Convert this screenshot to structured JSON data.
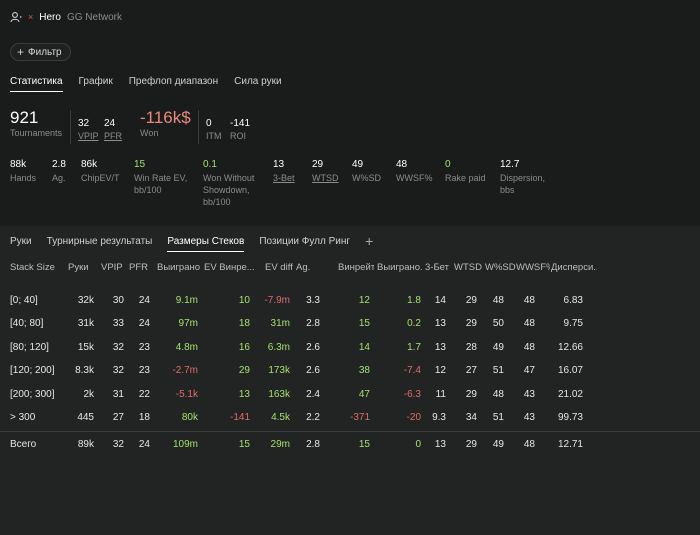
{
  "header": {
    "hero": "Hero",
    "network": "GG Network",
    "filter_label": "Фильтр"
  },
  "top_tabs": [
    "Статистика",
    "График",
    "Префлоп диапазон",
    "Сила руки"
  ],
  "big_stats": {
    "tournaments": {
      "value": "921",
      "label": "Tournaments"
    },
    "vpip": {
      "value": "32",
      "label": "VPIP"
    },
    "pfr": {
      "value": "24",
      "label": "PFR"
    },
    "won": {
      "value": "-116k$",
      "label": "Won"
    },
    "itm": {
      "value": "0",
      "label": "ITM"
    },
    "roi": {
      "value": "-141",
      "label": "ROI"
    }
  },
  "small_stats": [
    {
      "value": "88k",
      "label": "Hands",
      "green": false,
      "underline": false
    },
    {
      "value": "2.8",
      "label": "Ag.",
      "green": false,
      "underline": false
    },
    {
      "value": "86k",
      "label": "ChipEV/T",
      "green": false,
      "underline": false
    },
    {
      "value": "15",
      "label": "Win Rate EV, bb/100",
      "green": true,
      "underline": false
    },
    {
      "value": "0.1",
      "label": "Won Without Showdown, bb/100",
      "green": true,
      "underline": false
    },
    {
      "value": "13",
      "label": "3-Bet",
      "green": false,
      "underline": true
    },
    {
      "value": "29",
      "label": "WTSD",
      "green": false,
      "underline": true
    },
    {
      "value": "49",
      "label": "W%SD",
      "green": false,
      "underline": false
    },
    {
      "value": "48",
      "label": "WWSF%",
      "green": false,
      "underline": false
    },
    {
      "value": "0",
      "label": "Rake paid",
      "green": true,
      "underline": false
    },
    {
      "value": "12.7",
      "label": "Dispersion, bbs",
      "green": false,
      "underline": false
    }
  ],
  "bottom_tabs": [
    "Руки",
    "Турнирные результаты",
    "Размеры Стеков",
    "Позиции Фулл Ринг"
  ],
  "table": {
    "headers": [
      "Stack Size",
      "Руки",
      "VPIP",
      "PFR",
      "Выиграно",
      "EV Винре...",
      "EV diff",
      "Ag.",
      "Винрейт ...",
      "Выиграно...",
      "3-Бет",
      "WTSD",
      "W%SD",
      "WWSF%",
      "Дисперси..."
    ],
    "rows": [
      [
        "[0; 40]",
        "32k",
        "30",
        "24",
        "9.1m",
        "10",
        "-7.9m",
        "3.3",
        "12",
        "1.8",
        "14",
        "29",
        "48",
        "48",
        "6.83"
      ],
      [
        "[40; 80]",
        "31k",
        "33",
        "24",
        "97m",
        "18",
        "31m",
        "2.8",
        "15",
        "0.2",
        "13",
        "29",
        "50",
        "48",
        "9.75"
      ],
      [
        "[80; 120]",
        "15k",
        "32",
        "23",
        "4.8m",
        "16",
        "6.3m",
        "2.6",
        "14",
        "1.7",
        "13",
        "28",
        "49",
        "48",
        "12.66"
      ],
      [
        "[120; 200]",
        "8.3k",
        "32",
        "23",
        "-2.7m",
        "29",
        "173k",
        "2.6",
        "38",
        "-7.4",
        "12",
        "27",
        "51",
        "47",
        "16.07"
      ],
      [
        "[200; 300]",
        "2k",
        "31",
        "22",
        "-5.1k",
        "13",
        "163k",
        "2.4",
        "47",
        "-6.3",
        "11",
        "29",
        "48",
        "43",
        "21.02"
      ],
      [
        "> 300",
        "445",
        "27",
        "18",
        "80k",
        "-141",
        "4.5k",
        "2.2",
        "-371",
        "-20",
        "9.3",
        "34",
        "51",
        "43",
        "99.73"
      ]
    ],
    "total": [
      "Всего",
      "89k",
      "32",
      "24",
      "109m",
      "15",
      "29m",
      "2.8",
      "15",
      "0",
      "13",
      "29",
      "49",
      "48",
      "12.71"
    ]
  },
  "colors": {
    "positive": "#a3e06b",
    "negative": "#e06b6b",
    "background": "#1a1c1c",
    "table_background": "#222424"
  }
}
